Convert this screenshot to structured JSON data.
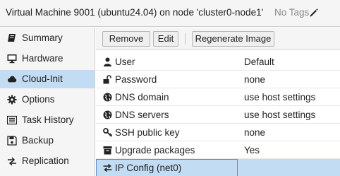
{
  "header": {
    "title": "Virtual Machine 9001 (ubuntu24.04) on node 'cluster0-node1'",
    "tags_label": "No Tags",
    "tag_edit_icon": "pencil-icon"
  },
  "sidebar": {
    "items": [
      {
        "label": "Summary",
        "icon": "book-icon"
      },
      {
        "label": "Hardware",
        "icon": "monitor-icon"
      },
      {
        "label": "Cloud-Init",
        "icon": "cloud-icon",
        "active": true
      },
      {
        "label": "Options",
        "icon": "gear-icon"
      },
      {
        "label": "Task History",
        "icon": "list-icon"
      },
      {
        "label": "Backup",
        "icon": "floppy-icon"
      },
      {
        "label": "Replication",
        "icon": "arrows-icon"
      }
    ]
  },
  "toolbar": {
    "remove_label": "Remove",
    "edit_label": "Edit",
    "regenerate_label": "Regenerate Image"
  },
  "cloudinit": {
    "rows": [
      {
        "label": "User",
        "value": "Default",
        "icon": "user-icon"
      },
      {
        "label": "Password",
        "value": "none",
        "icon": "unlock-icon"
      },
      {
        "label": "DNS domain",
        "value": "use host settings",
        "icon": "globe-icon"
      },
      {
        "label": "DNS servers",
        "value": "use host settings",
        "icon": "globe-icon"
      },
      {
        "label": "SSH public key",
        "value": "none",
        "icon": "key-icon"
      },
      {
        "label": "Upgrade packages",
        "value": "Yes",
        "icon": "archive-icon"
      },
      {
        "label": "IP Config (net0)",
        "value": "",
        "icon": "exchange-icon",
        "selected": true
      }
    ]
  },
  "colors": {
    "selection": "#c2dcf3",
    "panel": "#f5f5f5",
    "border": "#cfcfcf"
  }
}
